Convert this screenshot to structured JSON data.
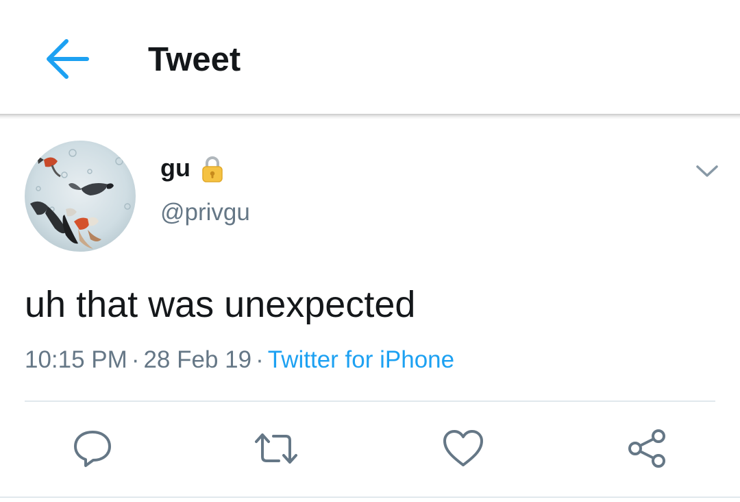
{
  "header": {
    "back_icon": "arrow-left-icon",
    "title": "Tweet"
  },
  "tweet": {
    "avatar_icon": "goldfish-avatar",
    "display_name": "gu",
    "lock_icon": "lock-icon",
    "handle": "@privgu",
    "caret_icon": "chevron-down-icon",
    "text": "uh that was unexpected",
    "time": "10:15 PM",
    "separator": "·",
    "date": "28 Feb 19",
    "source": "Twitter for iPhone"
  },
  "actions": {
    "reply_icon": "reply-icon",
    "retweet_icon": "retweet-icon",
    "like_icon": "heart-icon",
    "share_icon": "share-icon"
  },
  "colors": {
    "accent": "#1da1f2",
    "text": "#14171a",
    "secondary": "#657786",
    "divider": "#e1e8ed",
    "lock": "#f5c242"
  }
}
